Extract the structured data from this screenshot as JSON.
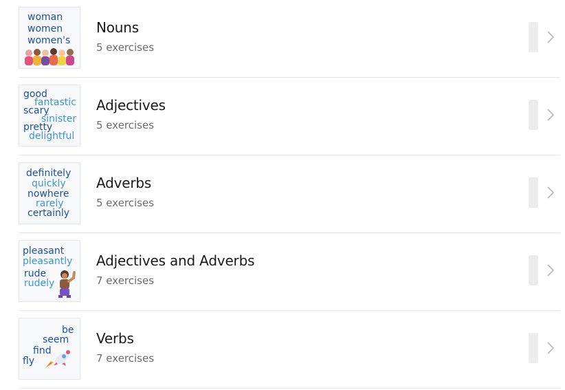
{
  "lessons": [
    {
      "title": "Nouns",
      "subtitle": "5 exercises",
      "thumb_words": [
        "woman",
        "women",
        "women's"
      ]
    },
    {
      "title": "Adjectives",
      "subtitle": "5 exercises",
      "thumb_words": [
        "good",
        "fantastic",
        "scary",
        "sinister",
        "pretty",
        "delightful"
      ]
    },
    {
      "title": "Adverbs",
      "subtitle": "5 exercises",
      "thumb_words": [
        "definitely",
        "quickly",
        "nowhere",
        "rarely",
        "certainly"
      ]
    },
    {
      "title": "Adjectives and Adverbs",
      "subtitle": "7 exercises",
      "thumb_words": [
        "pleasant",
        "pleasantly",
        "rude",
        "rudely"
      ]
    },
    {
      "title": "Verbs",
      "subtitle": "7 exercises",
      "thumb_words": [
        "be",
        "seem",
        "find",
        "fly"
      ]
    }
  ],
  "colors": {
    "word_dark": "#1f4f9c",
    "word_light": "#3d95d8",
    "progress_track": "#ececec",
    "chevron": "#b5b5b5"
  },
  "icons": {
    "row_chevron": "chevron-right-icon"
  }
}
